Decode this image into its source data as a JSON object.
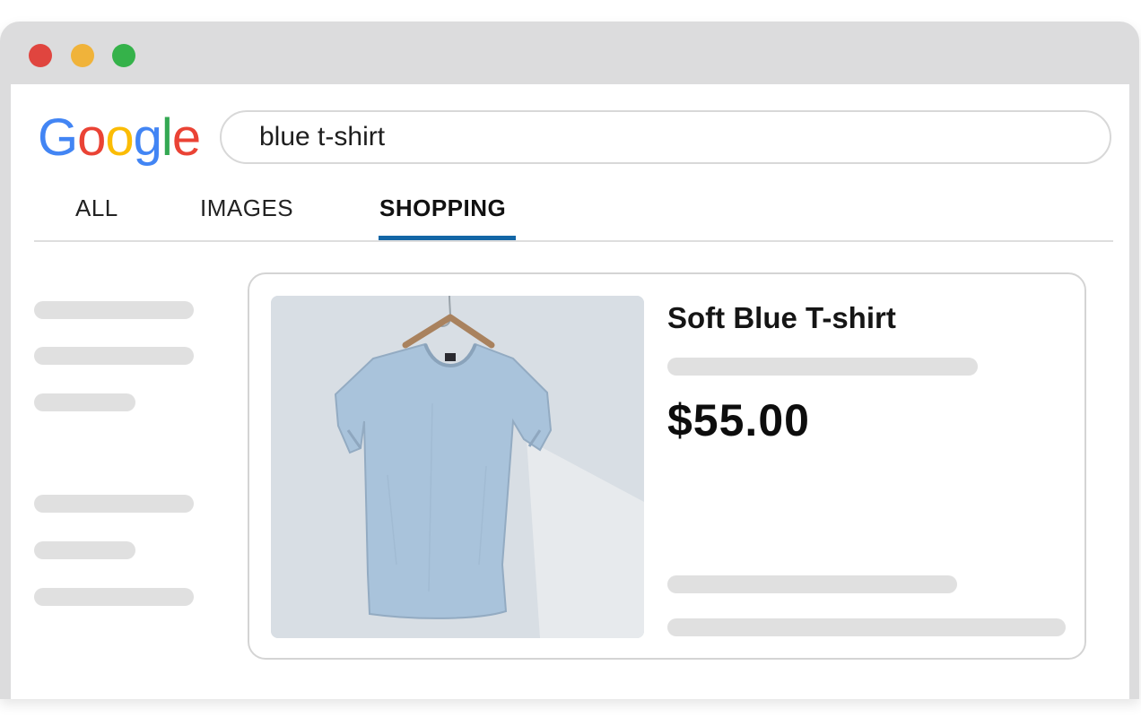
{
  "window": {
    "controls": [
      "close",
      "minimize",
      "maximize"
    ],
    "colors": {
      "close": "#e0453f",
      "minimize": "#f0b33a",
      "maximize": "#35b24a"
    }
  },
  "logo": {
    "text": "Google",
    "letters": [
      "G",
      "o",
      "o",
      "g",
      "l",
      "e"
    ],
    "colors": [
      "#4285F4",
      "#EA4335",
      "#FBBC05",
      "#4285F4",
      "#34A853",
      "#EA4335"
    ]
  },
  "search": {
    "value": "blue t-shirt"
  },
  "tabs": [
    {
      "label": "ALL",
      "active": false
    },
    {
      "label": "IMAGES",
      "active": false
    },
    {
      "label": "SHOPPING",
      "active": true
    }
  ],
  "accent_color": "#1366a6",
  "product": {
    "title": "Soft Blue T-shirt",
    "price": "$55.00",
    "image_icon": "t-shirt-on-hanger"
  }
}
